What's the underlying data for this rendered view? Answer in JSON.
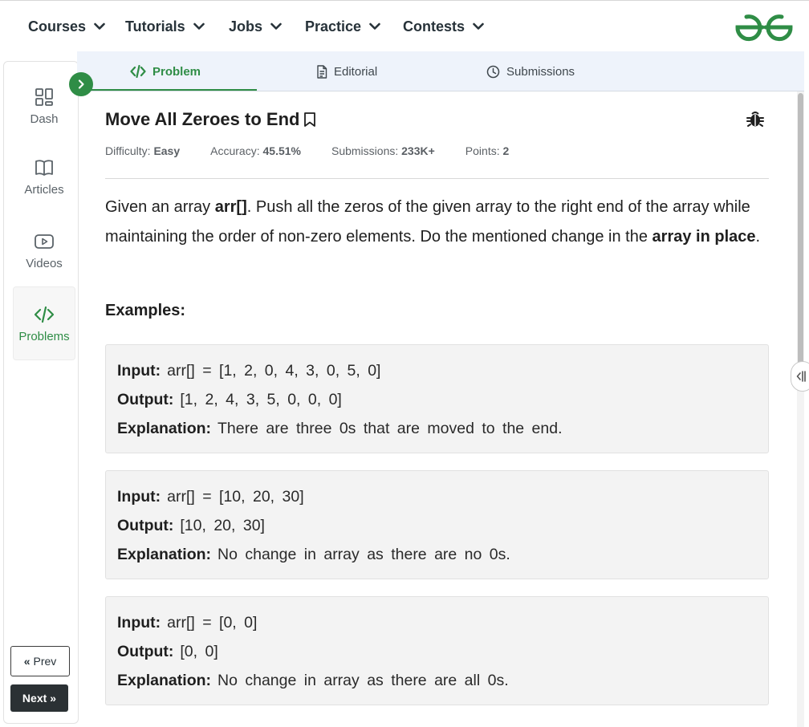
{
  "nav": {
    "items": [
      {
        "label": "Courses"
      },
      {
        "label": "Tutorials"
      },
      {
        "label": "Jobs"
      },
      {
        "label": "Practice"
      },
      {
        "label": "Contests"
      }
    ],
    "brand_color": "#2f8d46"
  },
  "sidebar": {
    "items": [
      {
        "label": "Dash",
        "icon": "dashboard-icon"
      },
      {
        "label": "Articles",
        "icon": "book-icon"
      },
      {
        "label": "Videos",
        "icon": "video-icon"
      },
      {
        "label": "Problems",
        "icon": "code-icon",
        "active": true
      }
    ],
    "prev_label": "Prev",
    "next_label": "Next"
  },
  "tabs": [
    {
      "label": "Problem",
      "icon": "code-icon",
      "active": true
    },
    {
      "label": "Editorial",
      "icon": "document-icon"
    },
    {
      "label": "Submissions",
      "icon": "clock-icon"
    }
  ],
  "problem": {
    "title": "Move All Zeroes to End",
    "meta": {
      "difficulty_label": "Difficulty:",
      "difficulty": "Easy",
      "accuracy_label": "Accuracy:",
      "accuracy": "45.51%",
      "submissions_label": "Submissions:",
      "submissions": "233K+",
      "points_label": "Points:",
      "points": "2"
    },
    "description": {
      "p1": "Given an array ",
      "b1": "arr[]",
      "p2": ". Push all the zeros of the given array to the right end of the array while maintaining the order of non-zero elements. Do the mentioned change in the ",
      "b2": "array in place",
      "p3": "."
    },
    "examples_heading": "Examples:",
    "labels": {
      "input": "Input:",
      "output": "Output:",
      "explanation": "Explanation:"
    },
    "examples": [
      {
        "input": "arr[] = [1, 2, 0, 4, 3, 0, 5, 0]",
        "output": "[1, 2, 4, 3, 5, 0, 0, 0]",
        "explanation": "There are three 0s that are moved to the end."
      },
      {
        "input": "arr[] = [10, 20, 30]",
        "output": "[10, 20, 30]",
        "explanation": "No change in array as there are no 0s."
      },
      {
        "input": "arr[] = [0, 0]",
        "output": "[0, 0]",
        "explanation": "No change in array as there are all 0s."
      }
    ]
  }
}
